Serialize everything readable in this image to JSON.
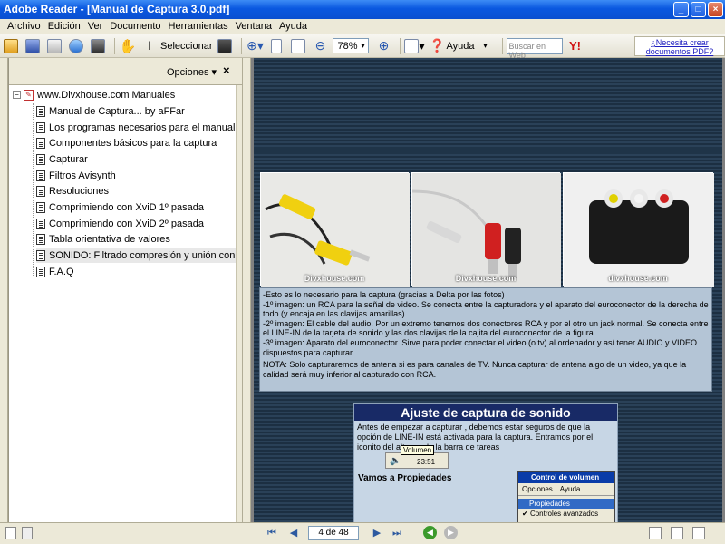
{
  "window": {
    "title": "Adobe Reader - [Manual de Captura 3.0.pdf]"
  },
  "menu": [
    "Archivo",
    "Edición",
    "Ver",
    "Documento",
    "Herramientas",
    "Ventana",
    "Ayuda"
  ],
  "toolbar": {
    "select_label": "Seleccionar",
    "zoom_value": "78%",
    "help_label": "Ayuda",
    "search_placeholder": "Buscar en Web",
    "promo_text": "¿Necesita crear documentos PDF?"
  },
  "navpanel": {
    "options_label": "Opciones",
    "close_label": "×",
    "root": "www.Divxhouse.com Manuales",
    "items": [
      "Manual de Captura... by aFFar",
      "Los programas necesarios para el manual",
      "Componentes básicos para la captura",
      "Capturar",
      "Filtros Avisynth",
      "Resoluciones",
      "Comprimiendo con XviD 1º pasada",
      "Comprimiendo con XviD 2º pasada",
      "Tabla orientativa de valores",
      "SONIDO: Filtrado compresión y unión con",
      "F.A.Q"
    ]
  },
  "document": {
    "watermarks": [
      "Divxhouse.com",
      "Divxhouse.com",
      "divxhouse.com"
    ],
    "info_paragraphs": [
      "-Esto es lo necesario para la captura (gracias a Delta por las fotos)",
      "-1º imagen: un RCA para la señal de video. Se conecta entre la capturadora y el aparato del euroconector de la derecha de todo (y encaja en las clavijas amarillas).",
      "-2º imagen:  El cable del audio. Por un extremo tenemos dos conectores RCA y por el otro un jack normal. Se conecta entre el LINE-IN de la tarjeta de sonido y las dos clavijas de la cajita del euroconector de la figura.",
      "-3º imagen: Aparato del euroconector. Sirve para poder conectar el video (o tv) al ordenador y así tener AUDIO y VIDEO dispuestos para capturar.",
      "NOTA: Solo capturaremos de antena si es para canales de TV. Nunca capturar de antena algo de un video, ya que la calidad será muy inferior al capturado con RCA."
    ],
    "audio_title": "Ajuste de captura de sonido",
    "audio_text": "Antes de empezar a capturar , debemos estar seguros de que la opción de LINE-IN está activada para la captura. Entramos por el iconito del altavoz de la barra de tareas",
    "volume_tooltip": "Volumen",
    "clock": "23:51",
    "vamos": "Vamos a Propiedades",
    "popup": {
      "title": "Control de volumen",
      "menu": [
        "Opciones",
        "Ayuda"
      ],
      "highlight": "Propiedades",
      "checked": "Controles avanzados"
    }
  },
  "statusbar": {
    "page_indicator": "4 de 48"
  }
}
